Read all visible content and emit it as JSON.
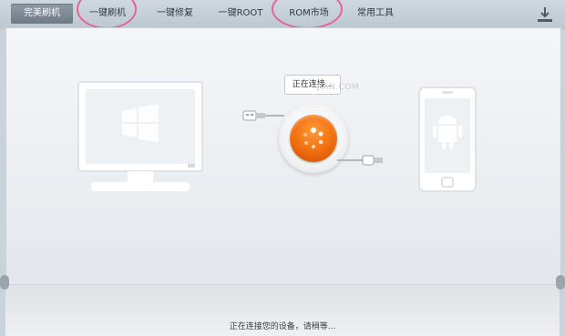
{
  "tabs": [
    {
      "label": "完美刷机",
      "active": true
    },
    {
      "label": "一键刷机",
      "active": false
    },
    {
      "label": "一键修复",
      "active": false
    },
    {
      "label": "一键ROOT",
      "active": false
    },
    {
      "label": "ROM市场",
      "active": false
    },
    {
      "label": "常用工具",
      "active": false
    }
  ],
  "tooltip": {
    "text": "正在连接..."
  },
  "watermark": {
    "text": "JIAN.COM"
  },
  "status": {
    "text": "正在连接您的设备，请稍等..."
  },
  "colors": {
    "accent": "#f06d0d",
    "highlight_circle": "#e56592"
  },
  "icons": [
    "computer-icon",
    "usb-plug-icon",
    "connect-button",
    "usb-cable-icon",
    "android-phone-icon",
    "download-icon"
  ]
}
